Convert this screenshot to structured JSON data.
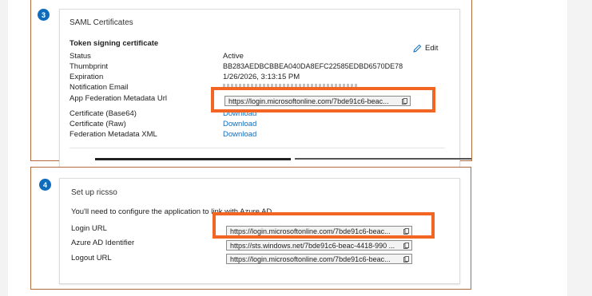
{
  "colors": {
    "accent": "#0f6cbd",
    "highlight": "#f26522",
    "snip_border": "#b06a3d"
  },
  "section3": {
    "step_number": "3",
    "title": "SAML Certificates",
    "subtitle": "Token signing certificate",
    "edit_label": "Edit",
    "rows": {
      "status_label": "Status",
      "status_value": "Active",
      "thumbprint_label": "Thumbprint",
      "thumbprint_value": "BB283AEDBCBBEA040DA8EFC22585EDBD6570DE78",
      "expiration_label": "Expiration",
      "expiration_value": "1/26/2026, 3:13:15 PM",
      "notification_label": "Notification Email",
      "app_fed_label": "App Federation Metadata Url",
      "app_fed_value": "https://login.microsoftonline.com/7bde91c6-beac...",
      "cert_base64_label": "Certificate (Base64)",
      "cert_base64_link": "Download",
      "cert_raw_label": "Certificate (Raw)",
      "cert_raw_link": "Download",
      "fed_xml_label": "Federation Metadata XML",
      "fed_xml_link": "Download"
    }
  },
  "section4": {
    "step_number": "4",
    "title": "Set up ricsso",
    "description": "You'll need to configure the application to link with Azure AD.",
    "login_url_label": "Login URL",
    "login_url_value": "https://login.microsoftonline.com/7bde91c6-beac...",
    "azure_id_label": "Azure AD Identifier",
    "azure_id_value": "https://sts.windows.net/7bde91c6-beac-4418-990 ...",
    "logout_url_label": "Logout URL",
    "logout_url_value": "https://login.microsoftonline.com/7bde91c6-beac..."
  }
}
